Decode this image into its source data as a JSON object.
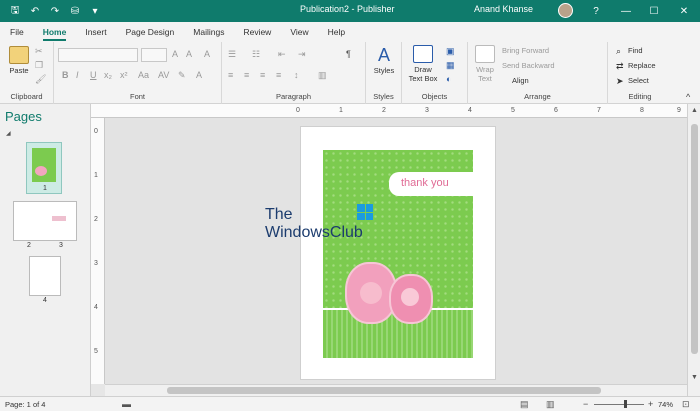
{
  "window": {
    "title": "Publication2  -  Publisher",
    "user_name": "Anand Khanse",
    "help": "?",
    "minimize": "—",
    "maximize": "☐",
    "close": "✕"
  },
  "quick_access": {
    "save_icon": "save-icon",
    "undo_icon": "undo-icon",
    "redo_icon": "redo-icon",
    "format_painter_icon": "paint-icon"
  },
  "tabs": [
    {
      "label": "File",
      "active": false
    },
    {
      "label": "Home",
      "active": true
    },
    {
      "label": "Insert",
      "active": false
    },
    {
      "label": "Page Design",
      "active": false
    },
    {
      "label": "Mailings",
      "active": false
    },
    {
      "label": "Review",
      "active": false
    },
    {
      "label": "View",
      "active": false
    },
    {
      "label": "Help",
      "active": false
    }
  ],
  "ribbon": {
    "clipboard": {
      "label": "Clipboard",
      "paste": "Paste"
    },
    "font": {
      "label": "Font"
    },
    "paragraph": {
      "label": "Paragraph"
    },
    "styles": {
      "label": "Styles",
      "styles_button": "Styles"
    },
    "objects": {
      "label": "Objects",
      "draw_text_box_1": "Draw",
      "draw_text_box_2": "Text Box"
    },
    "arrange": {
      "label": "Arrange",
      "wrap_text_1": "Wrap",
      "wrap_text_2": "Text",
      "bring_forward": "Bring Forward",
      "send_backward": "Send Backward",
      "align": "Align"
    },
    "editing": {
      "label": "Editing",
      "find": "Find",
      "replace": "Replace",
      "select": "Select"
    }
  },
  "pages_panel": {
    "title": "Pages",
    "thumbs": [
      "1",
      "2",
      "3",
      "4"
    ]
  },
  "ruler_h": [
    "0",
    "1",
    "2",
    "3",
    "4",
    "5",
    "6",
    "7",
    "8",
    "9"
  ],
  "ruler_v": [
    "0",
    "1",
    "2",
    "3",
    "4",
    "5"
  ],
  "card": {
    "text": "thank you"
  },
  "watermark": {
    "line1": "The",
    "line2": "WindowsClub"
  },
  "status": {
    "page": "Page: 1 of 4",
    "zoom": "74%",
    "zoom_minus": "−",
    "zoom_plus": "+"
  },
  "colors": {
    "accent": "#0f7b6c",
    "card_green": "#7ccb4f",
    "thank_you_pink": "#e06b95"
  }
}
